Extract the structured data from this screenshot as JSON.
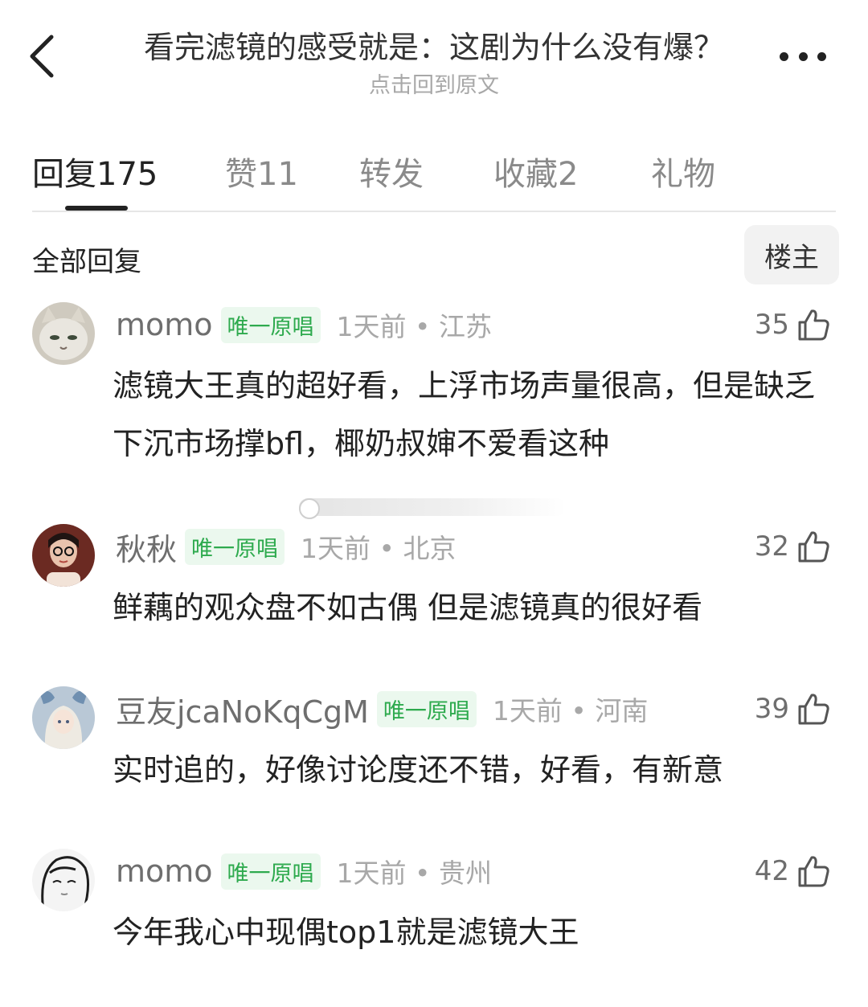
{
  "header": {
    "title": "看完滤镜的感受就是：这剧为什么没有爆？",
    "subtitle": "点击回到原文"
  },
  "tabs": [
    {
      "label": "回复",
      "count": "175",
      "active": true
    },
    {
      "label": "赞",
      "count": "11",
      "active": false
    },
    {
      "label": "转发",
      "count": "",
      "active": false
    },
    {
      "label": "收藏",
      "count": "2",
      "active": false
    },
    {
      "label": "礼物",
      "count": "",
      "active": false
    }
  ],
  "section": {
    "title": "全部回复",
    "filter_label": "楼主"
  },
  "comments": [
    {
      "username": "momo",
      "badge": "唯一原唱",
      "time": "1天前",
      "separator": "•",
      "location": "江苏",
      "likes": "35",
      "text": "滤镜大王真的超好看，上浮市场声量很高，但是缺乏下沉市场撑bfl，椰奶叔婶不爱看这种",
      "avatar_icon": "cat-avatar-icon"
    },
    {
      "username": "秋秋",
      "badge": "唯一原唱",
      "time": "1天前",
      "separator": "•",
      "location": "北京",
      "likes": "32",
      "text": "鲜藕的观众盘不如古偶 但是滤镜真的很好看",
      "avatar_icon": "girl-avatar-icon"
    },
    {
      "username": "豆友jcaNoKqCgM",
      "badge": "唯一原唱",
      "time": "1天前",
      "separator": "•",
      "location": "河南",
      "likes": "39",
      "text": "实时追的，好像讨论度还不错，好看，有新意",
      "avatar_icon": "anime-avatar-icon"
    },
    {
      "username": "momo",
      "badge": "唯一原唱",
      "time": "1天前",
      "separator": "•",
      "location": "贵州",
      "likes": "42",
      "text": "今年我心中现偶top1就是滤镜大王",
      "avatar_icon": "sketch-avatar-icon"
    }
  ],
  "colors": {
    "badge_text": "#2eaa4e",
    "badge_bg": "#ebf8ee",
    "muted": "#a8a8a8"
  }
}
